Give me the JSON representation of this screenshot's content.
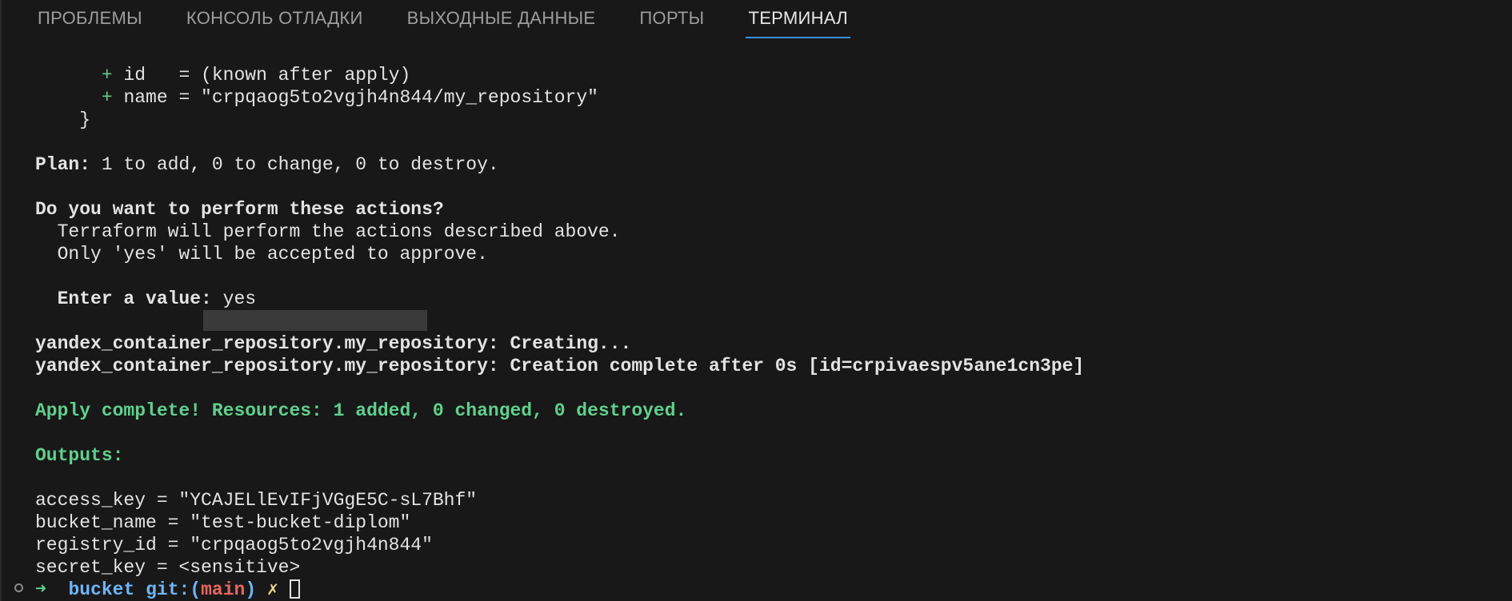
{
  "tabs": [
    {
      "label": "ПРОБЛЕМЫ"
    },
    {
      "label": "КОНСОЛЬ ОТЛАДКИ"
    },
    {
      "label": "ВЫХОДНЫЕ ДАННЫЕ"
    },
    {
      "label": "ПОРТЫ"
    },
    {
      "label": "ТЕРМИНАЛ"
    }
  ],
  "active_tab": "ТЕРМИНАЛ",
  "terminal": {
    "plus_id_sign": "+",
    "plus_id_text": " id   = (known after apply)",
    "plus_name_sign": "+",
    "plus_name_text": " name = \"crpqaog5to2vgjh4n844/my_repository\"",
    "closing_brace": "}",
    "plan_label": "Plan:",
    "plan_text": " 1 to add, 0 to change, 0 to destroy.",
    "question": "Do you want to perform these actions?",
    "info1": "Terraform will perform the actions described above.",
    "info2": "Only 'yes' will be accepted to approve.",
    "enter_label": "Enter a value:",
    "enter_value": " yes",
    "creating_resource": "yandex_container_repository.my_repository:",
    "creating_text": " Creating...",
    "complete_resource": "yandex_container_repository.my_repository:",
    "complete_text": " Creation complete after 0s [id=crpivaespv5ane1cn3pe]",
    "apply_complete": "Apply complete! Resources: 1 added, 0 changed, 0 destroyed.",
    "outputs_label": "Outputs:",
    "output_access_key": "access_key = \"YCAJELlEvIFjVGgE5C-sL7Bhf\"",
    "output_bucket_name": "bucket_name = \"test-bucket-diplom\"",
    "output_registry_id": "registry_id = \"crpqaog5to2vgjh4n844\"",
    "output_secret_key": "secret_key = <sensitive>",
    "prompt_arrow": "➜",
    "prompt_dir": "bucket",
    "prompt_git": "git:(",
    "prompt_branch": "main",
    "prompt_git_close": ")",
    "prompt_dirty": "✗"
  },
  "colors": {
    "background": "#181818",
    "green": "#6cc58d",
    "blue": "#6fb4f5",
    "red": "#e6675f",
    "active_tab_underline": "#3c8ee0"
  }
}
